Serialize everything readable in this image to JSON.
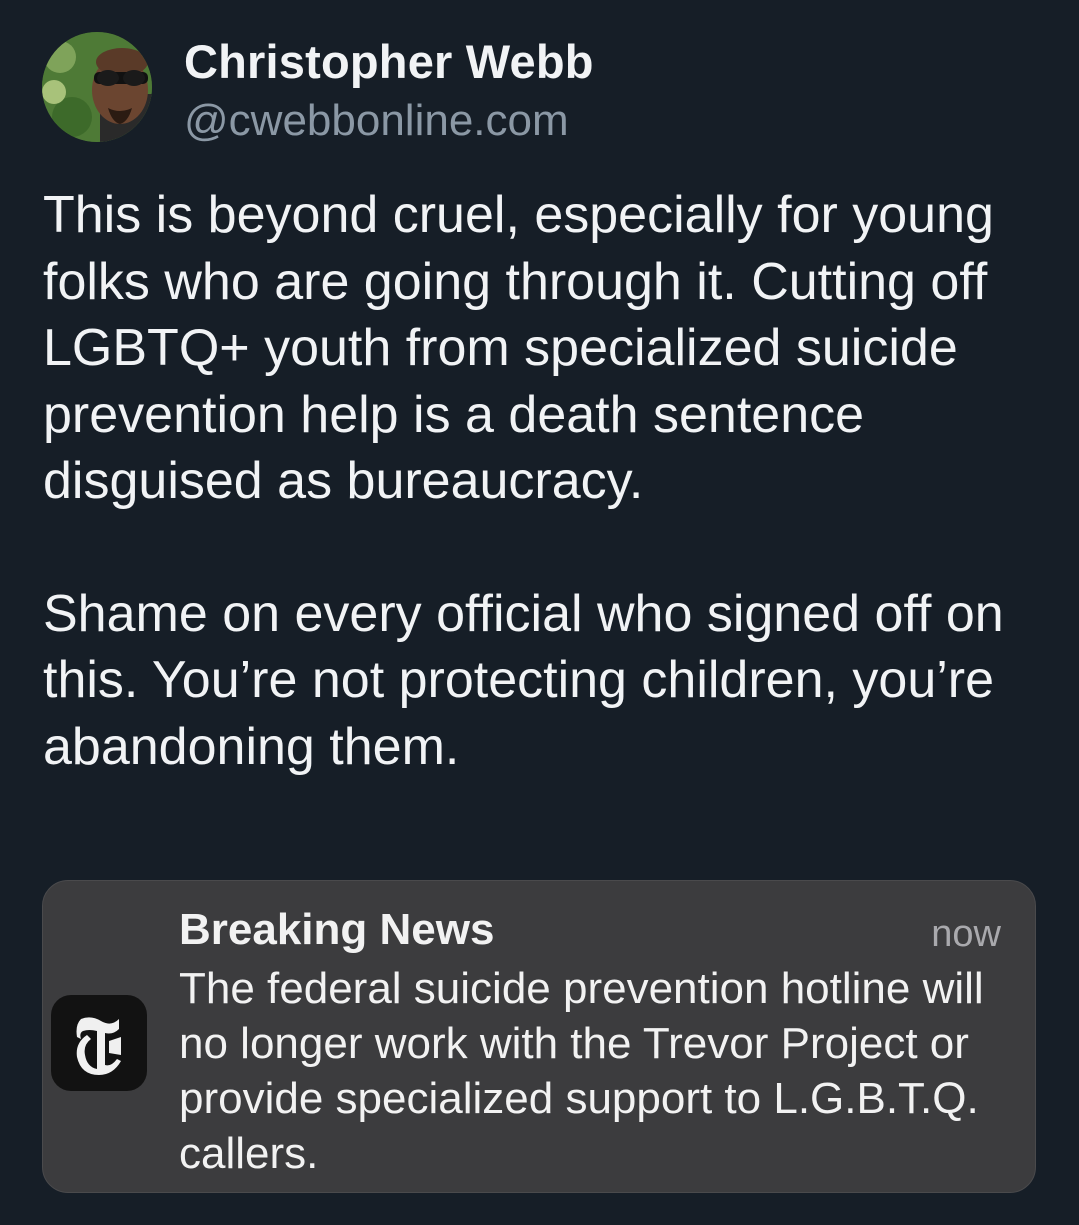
{
  "post": {
    "author": {
      "display_name": "Christopher Webb",
      "handle": "@cwebbonline.com",
      "avatar_icon": "user-avatar-photo"
    },
    "paragraphs": [
      "This is beyond cruel, especially for young folks who are going through it. Cutting off LGBTQ+ youth from specialized suicide prevention help is a death sentence disguised as bureaucracy.",
      "Shame on every official who signed off on this. You’re not protecting children, you’re abandoning them."
    ]
  },
  "notification": {
    "app_icon": "nyt-logo-icon",
    "title": "Breaking News",
    "time": "now",
    "body": "The federal suicide prevention hotline will no longer work with the Trevor Project or provide specialized support to L.G.B.T.Q. callers."
  },
  "colors": {
    "background": "#161e27",
    "text_primary": "#f1f3f5",
    "text_secondary": "#8b98a5",
    "card_background": "#3c3c3e"
  }
}
